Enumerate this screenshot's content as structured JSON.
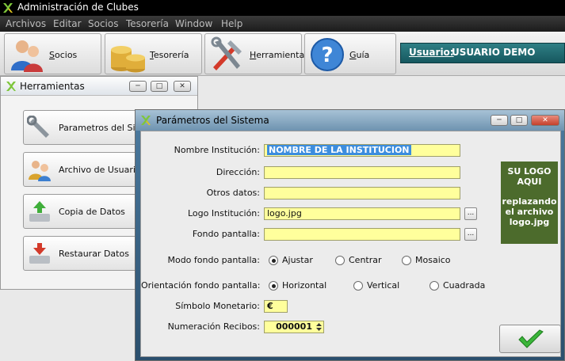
{
  "app": {
    "title": "Administración de Clubes"
  },
  "menu": [
    "Archivos",
    "Editar",
    "Socios",
    "Tesorería",
    "Window",
    "Help"
  ],
  "toolbar": {
    "socios": "Socios",
    "tesoreria": "Tesorería",
    "herramientas": "Herramientas",
    "guia": "Guía"
  },
  "user": {
    "label": "Usuario:",
    "name": "USUARIO DEMO"
  },
  "herramientas": {
    "title": "Herramientas",
    "items": [
      "Parametros del Sistema",
      "Archivo de Usuarios",
      "Copia de Datos",
      "Restaurar Datos"
    ]
  },
  "dialog": {
    "title": "Parámetros del Sistema",
    "fields": {
      "nombre": {
        "label": "Nombre Institución:",
        "value": "NOMBRE DE LA INSTITUCION"
      },
      "direccion": {
        "label": "Dirección:",
        "value": ""
      },
      "otros": {
        "label": "Otros datos:",
        "value": ""
      },
      "logo": {
        "label": "Logo Institución:",
        "value": "logo.jpg"
      },
      "fondo": {
        "label": "Fondo pantalla:",
        "value": ""
      }
    },
    "dots": "...",
    "modo": {
      "label": "Modo fondo pantalla:",
      "options": [
        "Ajustar",
        "Centrar",
        "Mosaico"
      ],
      "selected": "Ajustar"
    },
    "orientacion": {
      "label": "Orientación fondo pantalla:",
      "options": [
        "Horizontal",
        "Vertical",
        "Cuadrada"
      ],
      "selected": "Horizontal"
    },
    "simbolo": {
      "label": "Símbolo Monetario:",
      "value": "€"
    },
    "numeracion": {
      "label": "Numeración Recibos:",
      "value": "000001"
    },
    "logo_placeholder": {
      "line1": "SU LOGO",
      "line2": "AQUI",
      "line3": "replazando",
      "line4": "el archivo",
      "line5": "logo.jpg"
    }
  },
  "colors": {
    "accent": "#2f7f85",
    "field": "#ffff9c",
    "logo_bg": "#4c6b2c"
  }
}
